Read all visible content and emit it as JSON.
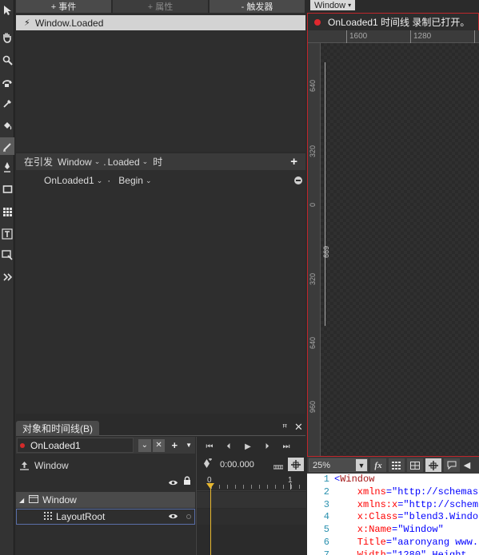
{
  "toolbar": {
    "tools": [
      "selection-tool",
      "pan-tool",
      "zoom-tool",
      "camera-orbit-tool",
      "eyedropper-tool",
      "paint-bucket-tool",
      "brush-transform-tool",
      "pen-tool",
      "rectangle-tool",
      "grid-tool",
      "text-tool",
      "asset-tool",
      "more-tools"
    ]
  },
  "triggers": {
    "add_event_label": "+ 事件",
    "add_property_label": "+ 属性",
    "remove_trigger_label": "- 触发器",
    "selected_trigger": "Window.Loaded",
    "condition": {
      "prefix": "在引发",
      "source": "Window",
      "dot": ".",
      "event": "Loaded",
      "suffix": "时"
    },
    "action": {
      "timeline": "OnLoaded1",
      "dot": "·",
      "verb": "Begin"
    }
  },
  "artboard": {
    "scope_dropdown": "Window",
    "recording_text": "OnLoaded1 时间线 录制已打开。",
    "ruler_top": [
      "1600",
      "1280"
    ],
    "ruler_left": [
      "640",
      "320",
      "0",
      "320",
      "640",
      "960"
    ],
    "height_label": "669",
    "zoom": "25%",
    "fx_label": "fx"
  },
  "xaml": {
    "lines": [
      {
        "n": "1",
        "parts": [
          [
            "br",
            "<"
          ],
          [
            "tag",
            "Window"
          ]
        ]
      },
      {
        "n": "2",
        "parts": [
          [
            "attr",
            "    xmlns"
          ],
          [
            "br",
            "="
          ],
          [
            "val",
            "\"http://schemas"
          ]
        ]
      },
      {
        "n": "3",
        "parts": [
          [
            "attr",
            "    xmlns:x"
          ],
          [
            "br",
            "="
          ],
          [
            "val",
            "\"http://schem"
          ]
        ]
      },
      {
        "n": "4",
        "parts": [
          [
            "attr",
            "    x:Class"
          ],
          [
            "br",
            "="
          ],
          [
            "val",
            "\"blend3.Windo"
          ]
        ]
      },
      {
        "n": "5",
        "parts": [
          [
            "attr",
            "    x:Name"
          ],
          [
            "br",
            "="
          ],
          [
            "val",
            "\"Window\""
          ]
        ]
      },
      {
        "n": "6",
        "parts": [
          [
            "attr",
            "    Title"
          ],
          [
            "br",
            "="
          ],
          [
            "val",
            "\"aaronyang www."
          ]
        ]
      },
      {
        "n": "7",
        "parts": [
          [
            "attr",
            "    Width"
          ],
          [
            "br",
            "="
          ],
          [
            "val",
            "\"1280\" Height"
          ]
        ]
      }
    ]
  },
  "objects": {
    "tab_label": "对象和时间线(B)",
    "timeline_name": "OnLoaded1",
    "scope": "Window",
    "time": "0:00.000",
    "tree": [
      {
        "label": "Window"
      },
      {
        "label": "LayoutRoot"
      }
    ],
    "ticks": [
      "0",
      "1"
    ]
  },
  "colors": {
    "record_red": "#c0262b",
    "playhead": "#e8b830",
    "selection_border": "#5a6fa8"
  }
}
